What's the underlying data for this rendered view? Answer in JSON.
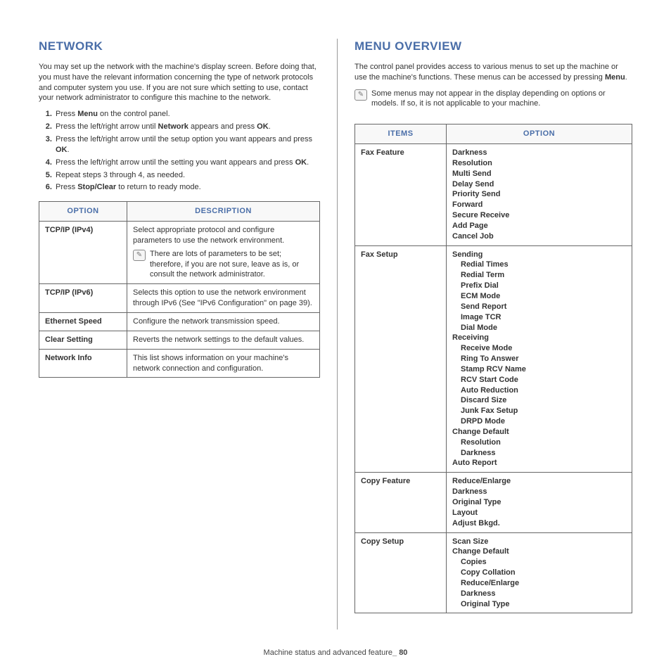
{
  "network": {
    "heading": "Network",
    "intro": "You may set up the network with the machine's display screen. Before doing that, you must have the relevant information concerning the type of network protocols and computer system you use. If you are not sure which setting to use, contact your network administrator to configure this machine to the network.",
    "steps": {
      "s1a": "Press ",
      "s1b": "Menu",
      "s1c": " on the control panel.",
      "s2a": "Press the left/right arrow until ",
      "s2b": "Network",
      "s2c": " appears and press ",
      "s2d": "OK",
      "s2e": ".",
      "s3a": "Press the left/right arrow until the setup option you want appears and press ",
      "s3b": "OK",
      "s3c": ".",
      "s4a": "Press the left/right arrow until the setting you want appears and press ",
      "s4b": "OK",
      "s4c": ".",
      "s5": "Repeat steps 3 through 4, as needed.",
      "s6a": "Press ",
      "s6b": "Stop/Clear",
      "s6c": " to return to ready mode."
    },
    "table": {
      "h1": "Option",
      "h2": "Description",
      "r1": {
        "opt": "TCP/IP (IPv4)",
        "desc": "Select appropriate protocol and configure parameters to use the network environment.",
        "note": "There are lots of parameters to be set; therefore, if you are not sure, leave as is, or consult the network administrator."
      },
      "r2": {
        "opt": "TCP/IP (IPv6)",
        "desc": "Selects this option to use the network environment through IPv6 (See \"IPv6 Configuration\" on page 39)."
      },
      "r3": {
        "opt": "Ethernet Speed",
        "desc": "Configure the network transmission speed."
      },
      "r4": {
        "opt": "Clear Setting",
        "desc": "Reverts the network settings to the default values."
      },
      "r5": {
        "opt": "Network Info",
        "desc": "This list shows information on your machine's network connection and configuration."
      }
    }
  },
  "menu": {
    "heading": "Menu Overview",
    "intro_a": "The control panel provides access to various menus to set up the machine or use the machine's functions. These menus can be accessed by pressing ",
    "intro_b": "Menu",
    "intro_c": ".",
    "note": "Some menus may not appear in the display depending on options or models. If so, it is not applicable to your machine.",
    "table": {
      "h1": "Items",
      "h2": "Option",
      "fax_feature": {
        "label": "Fax Feature",
        "items": [
          "Darkness",
          "Resolution",
          "Multi Send",
          "Delay Send",
          "Priority Send",
          "Forward",
          "Secure Receive",
          "Add Page",
          "Cancel Job"
        ]
      },
      "fax_setup": {
        "label": "Fax Setup",
        "sending": "Sending",
        "sending_items": [
          "Redial Times",
          "Redial Term",
          "Prefix Dial",
          "ECM Mode",
          "Send Report",
          "Image TCR",
          "Dial Mode"
        ],
        "receiving": "Receiving",
        "receiving_items": [
          "Receive Mode",
          "Ring To Answer",
          "Stamp RCV Name",
          "RCV Start Code",
          "Auto Reduction",
          "Discard Size",
          "Junk Fax Setup",
          "DRPD Mode"
        ],
        "change_default": "Change Default",
        "change_default_items": [
          "Resolution",
          "Darkness"
        ],
        "auto_report": "Auto Report"
      },
      "copy_feature": {
        "label": "Copy Feature",
        "items": [
          "Reduce/Enlarge",
          "Darkness",
          "Original Type",
          "Layout",
          "Adjust Bkgd."
        ]
      },
      "copy_setup": {
        "label": "Copy Setup",
        "scan_size": "Scan Size",
        "change_default": "Change Default",
        "change_default_items": [
          "Copies",
          "Copy Collation",
          "Reduce/Enlarge",
          "Darkness",
          "Original Type"
        ]
      }
    }
  },
  "footer": {
    "text_a": "Machine status and advanced feature",
    "text_b": "_ 80"
  }
}
